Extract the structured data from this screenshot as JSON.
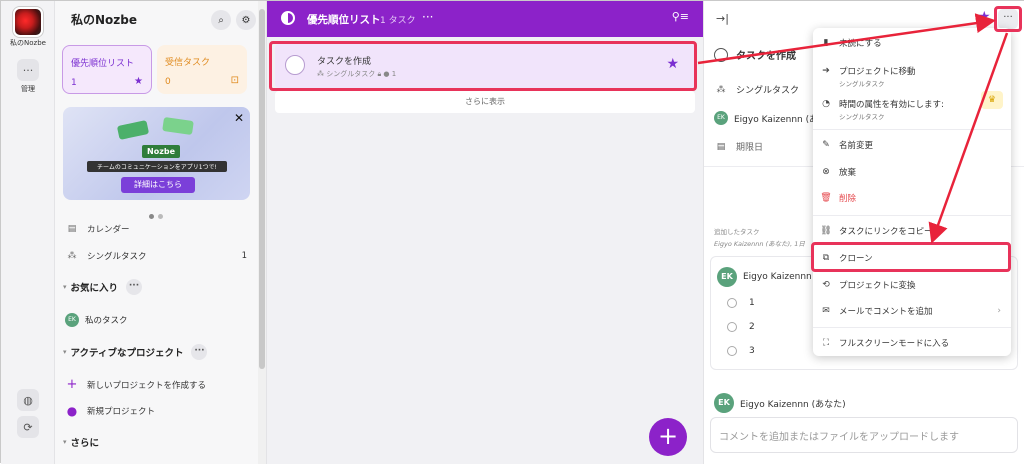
{
  "rail": {
    "workspace_label": "私のNozbe",
    "manage_label": "管理",
    "more_icon": "···"
  },
  "sidebar": {
    "title": "私のNozbe",
    "cards": [
      {
        "label": "優先順位リスト",
        "count": "1"
      },
      {
        "label": "受信タスク",
        "count": "0"
      }
    ],
    "promo": {
      "brand": "Nozbe",
      "tagline": "チームのコミュニケーションをアプリ1つで!",
      "button": "詳細はこちら"
    },
    "items": [
      {
        "label": "カレンダー",
        "count": ""
      },
      {
        "label": "シングルタスク",
        "count": "1"
      }
    ],
    "favorites_title": "お気に入り",
    "favorites": [
      {
        "label": "私のタスク",
        "avatar": "EK"
      }
    ],
    "active_projects_title": "アクティブなプロジェクト",
    "projects": [
      {
        "label": "新しいプロジェクトを作成する"
      },
      {
        "label": "新規プロジェクト"
      }
    ],
    "more_title": "さらに"
  },
  "center": {
    "title": "優先順位リスト",
    "count": "1 タスク",
    "task": {
      "name": "タスクを作成",
      "meta_project": "シングルタスク",
      "meta_comments": "1"
    },
    "show_more": "さらに表示"
  },
  "detail": {
    "task_name": "タスクを作成",
    "project": "シングルタスク",
    "assignee": "Eigyo Kaizennn (あな",
    "due": "期限日",
    "added_label": "追加したタスク",
    "added_by": "Eigyo Kaizennn (あなた), 1日",
    "comment_author": "Eigyo Kaizennn (",
    "checklist": [
      "1",
      "2",
      "3"
    ],
    "comment_author2": "Eigyo Kaizennn (あなた)",
    "comment_placeholder": "コメントを追加またはファイルをアップロードします",
    "avatar": "EK"
  },
  "menu": {
    "items": [
      {
        "label": "未読にする",
        "icon": "bookmark-icon"
      },
      {
        "label": "プロジェクトに移動",
        "sub": "シングルタスク",
        "icon": "move-icon"
      },
      {
        "label": "時間の属性を有効にします:",
        "sub": "シングルタスク",
        "icon": "clock-icon"
      },
      {
        "label": "名前変更",
        "icon": "pencil-icon"
      },
      {
        "label": "放棄",
        "icon": "abandon-icon"
      },
      {
        "label": "削除",
        "icon": "trash-icon"
      },
      {
        "label": "タスクにリンクをコピー",
        "icon": "link-icon"
      },
      {
        "label": "クローン",
        "icon": "clone-icon"
      },
      {
        "label": "プロジェクトに変換",
        "icon": "convert-icon"
      },
      {
        "label": "メールでコメントを追加",
        "icon": "mail-icon"
      },
      {
        "label": "フルスクリーンモードに入る",
        "icon": "fullscreen-icon"
      }
    ]
  },
  "colors": {
    "accent": "#8c22c9",
    "highlight": "#e8335a",
    "danger": "#e5484d"
  }
}
